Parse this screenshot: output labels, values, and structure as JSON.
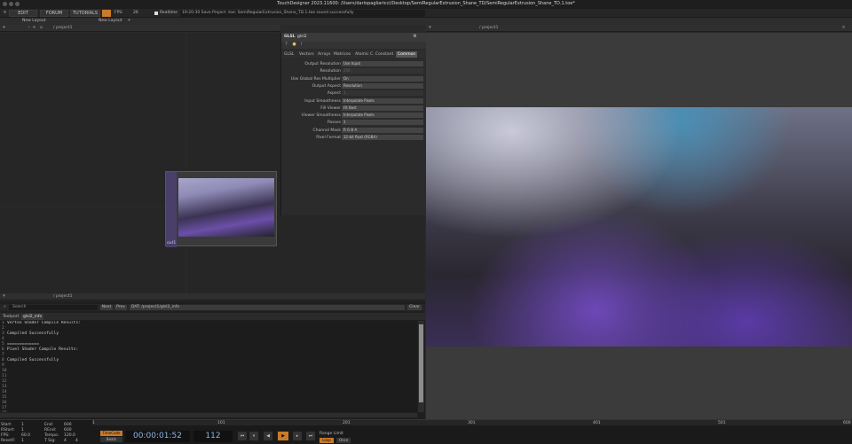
{
  "window": {
    "title": "TouchDesigner 2023.11600: /Users/dariopagliaricci/Desktop/SemiRegularExtrusion_Shane_TD/SemiRegularExtrusion_Shane_TD.1.toe*"
  },
  "menubar": {
    "items": [
      "EDIT",
      "FORUM",
      "TUTORIALS"
    ],
    "fps_label": "FPS:",
    "fps_value": "26",
    "realtime_label": "Realtime",
    "status": "19:20:30 Save Project .toe: SemiRegularExtrusion_Shane_TD.1.toe saved successfully",
    "layout1": "New Layout",
    "layout2": "New Layout"
  },
  "network": {
    "path": "/ project1",
    "node_label": "out1"
  },
  "viewer": {
    "path": "/ project1"
  },
  "params": {
    "op_type": "GLSL",
    "op_name": "glsl2",
    "tabs": [
      "GLSL",
      "Vectors",
      "Arrays",
      "Matrices",
      "Atomic C.",
      "Constant",
      "Common"
    ],
    "active_tab": "Common",
    "rows": [
      {
        "label": "Output Resolution",
        "value": "Use Input",
        "dim": false
      },
      {
        "label": "Resolution",
        "value": "256",
        "dim": true
      },
      {
        "label": "Use Global Res Multiplier",
        "value": "On",
        "dim": false
      },
      {
        "label": "Output Aspect",
        "value": "Resolution",
        "dim": false
      },
      {
        "label": "Aspect",
        "value": "1",
        "dim": true
      },
      {
        "label": "Input Smoothness",
        "value": "Interpolate Pixels",
        "dim": false
      },
      {
        "label": "Fill Viewer",
        "value": "Fit Best",
        "dim": false
      },
      {
        "label": "Viewer Smoothness",
        "value": "Interpolate Pixels",
        "dim": false
      },
      {
        "label": "Passes",
        "value": "1",
        "dim": false
      },
      {
        "label": "Channel Mask",
        "value": "R G B A",
        "dim": false
      },
      {
        "label": "Pixel Format",
        "value": "32-bit float (RGBA)",
        "dim": false
      }
    ]
  },
  "textport": {
    "search_placeholder": "Search",
    "next": "Next",
    "prev": "Prev",
    "dat_path": "DAT: /project1/glsl2_info",
    "clear": "Clear",
    "tabs": [
      "Textport",
      "glsl2_info"
    ],
    "lines": [
      "Vertex Shader Compile Results:",
      "",
      "Compiled Successfully",
      "",
      "=============",
      "Pixel Shader Compile Results:",
      "",
      "Compiled Successfully",
      "",
      "",
      "",
      "",
      "",
      "",
      "",
      "",
      "",
      "",
      ""
    ]
  },
  "timeline": {
    "start_label": "Start:",
    "start": "1",
    "end_label": "End:",
    "end": "600",
    "rstart_label": "RStart:",
    "rstart": "1",
    "rend_label": "REnd:",
    "rend": "600",
    "fps_label": "FPS:",
    "fps": "60.0",
    "tempo_label": "Tempo:",
    "tempo": "120.0",
    "reset_label": "ResetF:",
    "reset": "1",
    "tsig_label": "T Sig:",
    "tsig_a": "4",
    "tsig_b": "4",
    "timecode_btn": "TimeCode",
    "beats_btn": "Beats",
    "timecode": "00:00:01:52",
    "frame": "112",
    "range_label": "Range Limit",
    "loop": "Loop",
    "once": "Once",
    "ruler": [
      "1",
      "101",
      "201",
      "301",
      "401",
      "501",
      "600"
    ]
  }
}
